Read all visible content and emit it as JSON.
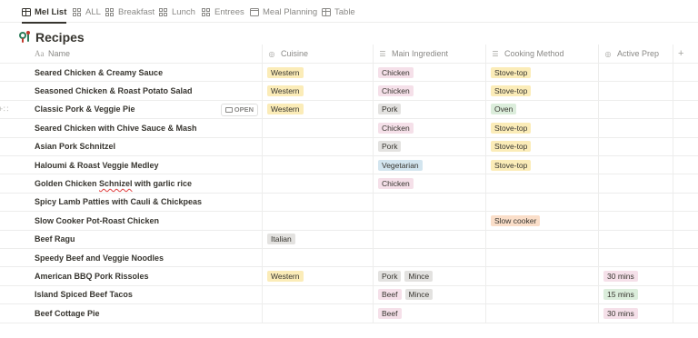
{
  "views": [
    {
      "label": "Mel List",
      "icon": "table-icon",
      "active": true
    },
    {
      "label": "ALL",
      "icon": "gallery-icon",
      "active": false
    },
    {
      "label": "Breakfast",
      "icon": "gallery-icon",
      "active": false
    },
    {
      "label": "Lunch",
      "icon": "gallery-icon",
      "active": false
    },
    {
      "label": "Entrees",
      "icon": "gallery-icon",
      "active": false
    },
    {
      "label": "Meal Planning",
      "icon": "calendar-icon",
      "active": false
    },
    {
      "label": "Table",
      "icon": "table-icon",
      "active": false
    }
  ],
  "page": {
    "title": "Recipes",
    "icon": "chef-icon"
  },
  "columns": {
    "name": "Name",
    "cuisine": "Cuisine",
    "main_ingredient": "Main Ingredient",
    "cooking_method": "Cooking Method",
    "active_prep": "Active Prep",
    "add": "+"
  },
  "open_label": "OPEN",
  "colors": {
    "yellow": "#fbecb8",
    "pink": "#f5e0e9",
    "gray": "#e3e2e0",
    "green": "#dbeddb",
    "blue": "#d3e5ef",
    "orange": "#fadec9",
    "red": "#ffe2dd",
    "text": "#37352f",
    "muted": "#8a8986",
    "border": "#ededec"
  },
  "rows": [
    {
      "name": "Seared Chicken & Creamy Sauce",
      "cuisine": [
        {
          "t": "Western",
          "c": "yellow"
        }
      ],
      "ingredient": [
        {
          "t": "Chicken",
          "c": "pink"
        }
      ],
      "method": [
        {
          "t": "Stove-top",
          "c": "yellow"
        }
      ],
      "prep": []
    },
    {
      "name": "Seasoned Chicken & Roast Potato Salad",
      "cuisine": [
        {
          "t": "Western",
          "c": "yellow"
        }
      ],
      "ingredient": [
        {
          "t": "Chicken",
          "c": "pink"
        }
      ],
      "method": [
        {
          "t": "Stove-top",
          "c": "yellow"
        }
      ],
      "prep": []
    },
    {
      "name": "Classic Pork & Veggie Pie",
      "cuisine": [
        {
          "t": "Western",
          "c": "yellow"
        }
      ],
      "ingredient": [
        {
          "t": "Pork",
          "c": "gray"
        }
      ],
      "method": [
        {
          "t": "Oven",
          "c": "green"
        }
      ],
      "prep": [],
      "hover": true
    },
    {
      "name": "Seared Chicken with Chive Sauce & Mash",
      "cuisine": [],
      "ingredient": [
        {
          "t": "Chicken",
          "c": "pink"
        }
      ],
      "method": [
        {
          "t": "Stove-top",
          "c": "yellow"
        }
      ],
      "prep": []
    },
    {
      "name": "Asian Pork Schnitzel",
      "cuisine": [],
      "ingredient": [
        {
          "t": "Pork",
          "c": "gray"
        }
      ],
      "method": [
        {
          "t": "Stove-top",
          "c": "yellow"
        }
      ],
      "prep": []
    },
    {
      "name": "Haloumi & Roast Veggie Medley",
      "cuisine": [],
      "ingredient": [
        {
          "t": "Vegetarian",
          "c": "blue"
        }
      ],
      "method": [
        {
          "t": "Stove-top",
          "c": "yellow"
        }
      ],
      "prep": []
    },
    {
      "name": "Golden Chicken Schnizel with garlic rice",
      "name_parts": [
        "Golden Chicken ",
        "Schnizel",
        " with garlic rice"
      ],
      "cuisine": [],
      "ingredient": [
        {
          "t": "Chicken",
          "c": "pink"
        }
      ],
      "method": [],
      "prep": []
    },
    {
      "name": "Spicy Lamb Patties with Cauli & Chickpeas",
      "cuisine": [],
      "ingredient": [],
      "method": [],
      "prep": []
    },
    {
      "name": "Slow Cooker Pot-Roast Chicken",
      "cuisine": [],
      "ingredient": [],
      "method": [
        {
          "t": "Slow cooker",
          "c": "orange"
        }
      ],
      "prep": []
    },
    {
      "name": "Beef Ragu",
      "cuisine": [
        {
          "t": "Italian",
          "c": "gray"
        }
      ],
      "ingredient": [],
      "method": [],
      "prep": []
    },
    {
      "name": "Speedy Beef and Veggie Noodles",
      "cuisine": [],
      "ingredient": [],
      "method": [],
      "prep": []
    },
    {
      "name": "American BBQ Pork Rissoles",
      "cuisine": [
        {
          "t": "Western",
          "c": "yellow"
        }
      ],
      "ingredient": [
        {
          "t": "Pork",
          "c": "gray"
        },
        {
          "t": "Mince",
          "c": "gray"
        }
      ],
      "method": [],
      "prep": [
        {
          "t": "30 mins",
          "c": "pink"
        }
      ]
    },
    {
      "name": "Island Spiced Beef Tacos",
      "cuisine": [],
      "ingredient": [
        {
          "t": "Beef",
          "c": "pink"
        },
        {
          "t": "Mince",
          "c": "gray"
        }
      ],
      "method": [],
      "prep": [
        {
          "t": "15 mins",
          "c": "green"
        }
      ]
    },
    {
      "name": "Beef Cottage Pie",
      "cuisine": [],
      "ingredient": [
        {
          "t": "Beef",
          "c": "pink"
        }
      ],
      "method": [],
      "prep": [
        {
          "t": "30 mins",
          "c": "pink"
        }
      ]
    }
  ]
}
